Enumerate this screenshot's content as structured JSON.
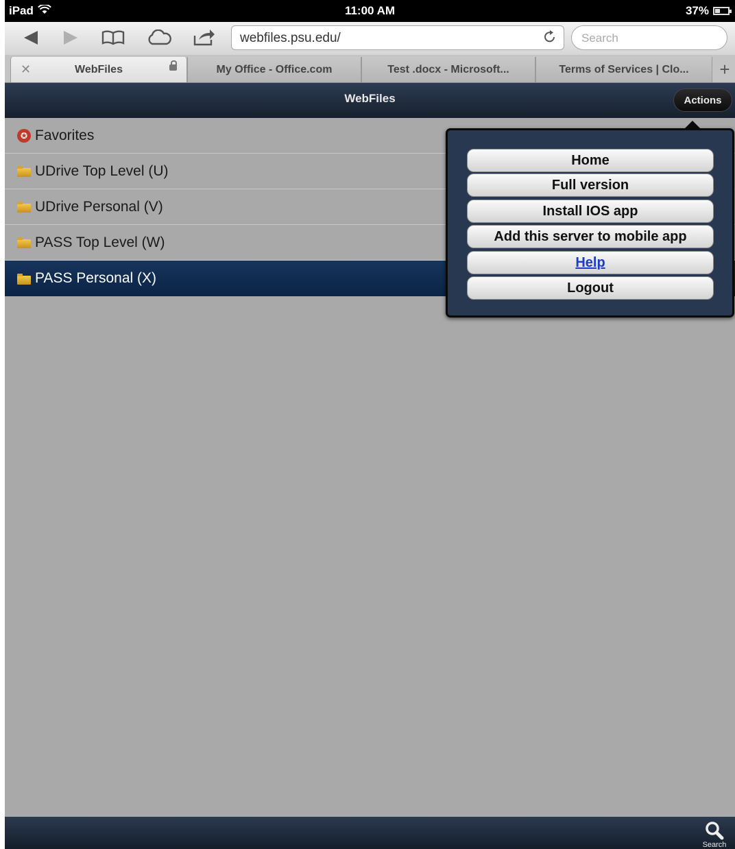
{
  "status_bar": {
    "device": "iPad",
    "time": "11:00 AM",
    "battery": "37%",
    "battery_level": 0.37
  },
  "toolbar": {
    "icons": [
      "back-icon",
      "forward-icon",
      "bookmarks-icon",
      "icloud-icon",
      "share-icon"
    ],
    "url": "webfiles.psu.edu/",
    "search_placeholder": "Search"
  },
  "tabs": [
    {
      "label": "WebFiles",
      "active": true
    },
    {
      "label": "My Office - Office.com",
      "active": false
    },
    {
      "label": "Test .docx - Microsoft...",
      "active": false
    },
    {
      "label": "Terms of Services | Clo...",
      "active": false
    }
  ],
  "header": {
    "title": "WebFiles",
    "actions_label": "Actions"
  },
  "items": [
    {
      "label": "Favorites",
      "icon": "favorites-icon",
      "selected": false
    },
    {
      "label": "UDrive Top Level (U)",
      "icon": "folder-icon",
      "selected": false
    },
    {
      "label": "UDrive Personal (V)",
      "icon": "folder-icon",
      "selected": false
    },
    {
      "label": "PASS Top Level (W)",
      "icon": "folder-icon",
      "selected": false
    },
    {
      "label": "PASS Personal (X)",
      "icon": "folder-icon",
      "selected": true
    }
  ],
  "actions_menu": [
    {
      "label": "Home"
    },
    {
      "label": "Full version"
    },
    {
      "label": "Install IOS app"
    },
    {
      "label": "Add this server to mobile app"
    },
    {
      "label": "Help",
      "link": true
    },
    {
      "label": "Logout"
    }
  ],
  "bottom_bar": {
    "search_label": "Search"
  }
}
